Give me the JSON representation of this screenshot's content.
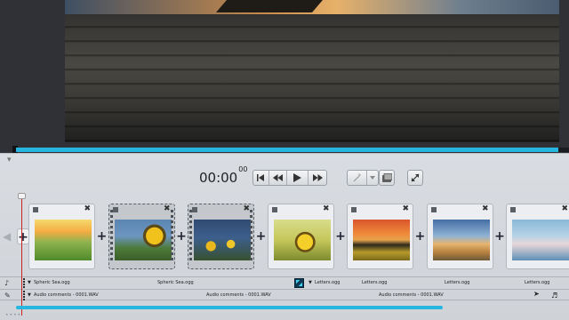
{
  "player": {
    "timecode_main": "00:00",
    "timecode_frames": "00",
    "progress_fraction": 0.98,
    "bottom_progress_fraction": 0.75
  },
  "controls": {
    "group1": [
      "skip-to-start-icon",
      "rewind-icon",
      "play-icon",
      "fast-forward-icon"
    ],
    "group2": [
      "magic-wand-icon",
      "dropdown-icon",
      "snapshot-icon"
    ],
    "fullscreen": "expand-icon"
  },
  "clips": [
    {
      "name": "clip-1",
      "thumb": "t1",
      "selected": false
    },
    {
      "name": "clip-2",
      "thumb": "t2",
      "selected": true
    },
    {
      "name": "clip-3",
      "thumb": "t3",
      "selected": true
    },
    {
      "name": "clip-4",
      "thumb": "t4",
      "selected": false
    },
    {
      "name": "clip-5",
      "thumb": "t5",
      "selected": false
    },
    {
      "name": "clip-6",
      "thumb": "t6",
      "selected": false
    },
    {
      "name": "clip-7",
      "thumb": "t7",
      "selected": false
    }
  ],
  "music_track": {
    "items": [
      "Spheric Sea.ogg",
      "Spheric Sea.ogg",
      "Letters.ogg",
      "Letters.ogg",
      "Letters.ogg",
      "Letters.ogg"
    ]
  },
  "comments_track": {
    "items": [
      "Audio comments - 0001.WAV",
      "Audio comments - 0001.WAV",
      "Audio comments - 0001.WAV"
    ]
  },
  "colors": {
    "accent": "#26b6e0",
    "playhead": "#cc2222"
  }
}
